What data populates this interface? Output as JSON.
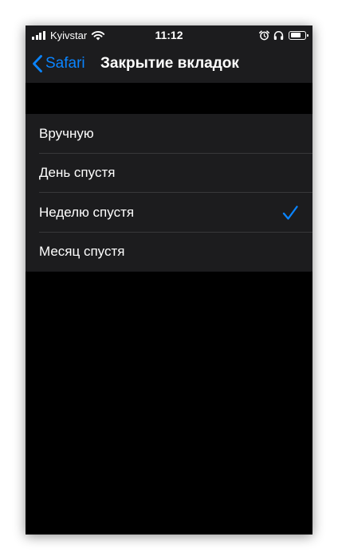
{
  "status_bar": {
    "carrier": "Kyivstar",
    "time": "11:12",
    "battery_level": 0.75
  },
  "nav": {
    "back_label": "Safari",
    "title": "Закрытие вкладок"
  },
  "options": [
    {
      "label": "Вручную",
      "selected": false
    },
    {
      "label": "День спустя",
      "selected": false
    },
    {
      "label": "Неделю спустя",
      "selected": true
    },
    {
      "label": "Месяц спустя",
      "selected": false
    }
  ],
  "colors": {
    "accent": "#0a84ff",
    "background": "#000000",
    "group_background": "#1c1c1e",
    "separator": "#38383a"
  },
  "icons": {
    "back": "chevron-left-icon",
    "selected": "checkmark-icon"
  }
}
